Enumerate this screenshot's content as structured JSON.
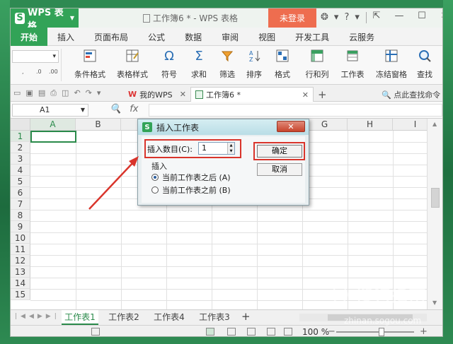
{
  "app": {
    "brand": "WPS 表格",
    "title": "工作簿6 * - WPS 表格",
    "login_label": "未登录",
    "help": "?"
  },
  "menu": {
    "items": [
      "开始",
      "插入",
      "页面布局",
      "公式",
      "数据",
      "审阅",
      "视图",
      "开发工具",
      "云服务"
    ],
    "active_index": 0
  },
  "ribbon": {
    "small_labels": [
      ",",
      ".0",
      ".00"
    ],
    "groups": [
      {
        "label": "条件格式",
        "icon": "conditional-format-icon"
      },
      {
        "label": "表格样式",
        "icon": "table-style-icon"
      },
      {
        "label": "符号",
        "icon": "omega-icon",
        "glyph": "Ω"
      },
      {
        "label": "求和",
        "icon": "sigma-icon",
        "glyph": "Σ"
      },
      {
        "label": "筛选",
        "icon": "filter-icon"
      },
      {
        "label": "排序",
        "icon": "sort-icon"
      },
      {
        "label": "格式",
        "icon": "format-icon"
      },
      {
        "label": "行和列",
        "icon": "rows-cols-icon"
      },
      {
        "label": "工作表",
        "icon": "worksheet-icon"
      },
      {
        "label": "冻结窗格",
        "icon": "freeze-icon"
      },
      {
        "label": "查找",
        "icon": "find-icon"
      }
    ]
  },
  "doc_tabs": {
    "tab1": "我的WPS",
    "tab2": "工作簿6 *",
    "find_command": "点此查找命令"
  },
  "formula_bar": {
    "cell_ref": "A1",
    "fx": "fx"
  },
  "grid": {
    "columns": [
      "A",
      "B",
      "C",
      "D",
      "E",
      "F",
      "G",
      "H",
      "I"
    ],
    "rows": [
      "1",
      "2",
      "3",
      "4",
      "5",
      "6",
      "7",
      "8",
      "9",
      "10",
      "11",
      "12",
      "13",
      "14",
      "15"
    ],
    "selected_cell": "A1"
  },
  "sheets": {
    "tabs": [
      "工作表1",
      "工作表2",
      "工作表4",
      "工作表3"
    ],
    "active_index": 0
  },
  "status": {
    "zoom": "100 %"
  },
  "dialog": {
    "title": "插入工作表",
    "count_label": "插入数目(C):",
    "count_value": "1",
    "insert_group_label": "插入",
    "option_after": "当前工作表之后 (A)",
    "option_before": "当前工作表之前 (B)",
    "selected_option": "after",
    "ok_label": "确定",
    "cancel_label": "取消"
  },
  "annotation": {
    "highlight_color": "#d9342b"
  },
  "watermark": {
    "text": "搜狗指南",
    "url": "zhinan.sogou.com"
  }
}
